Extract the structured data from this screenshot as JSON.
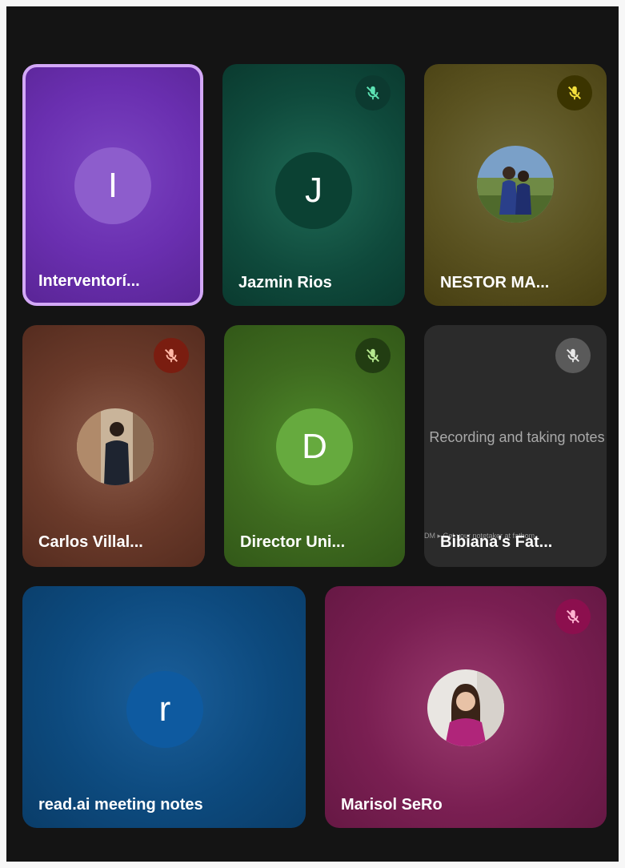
{
  "participants": [
    {
      "name": "Interventorí...",
      "initial": "I",
      "muted": false,
      "active": true,
      "background": "#6a2fb0",
      "avatar_color": "#8d5dcc"
    },
    {
      "name": "Jazmin Rios",
      "initial": "J",
      "muted": true,
      "active": false,
      "background": "#0f4a3c",
      "avatar_color": "#0b4133",
      "mute_badge_color": "#0c3a30",
      "mute_icon_color": "#5de3b4"
    },
    {
      "name": "NESTOR MA...",
      "photo": true,
      "muted": true,
      "active": false,
      "background": "#5a5220",
      "mute_badge_color": "#3b3400",
      "mute_icon_color": "#f3df3c"
    },
    {
      "name": "Carlos Villal...",
      "photo": true,
      "muted": true,
      "active": false,
      "background": "#6a3a2a",
      "mute_badge_color": "#7a1d10",
      "mute_icon_color": "#ffb7a5"
    },
    {
      "name": "Director Uni...",
      "initial": "D",
      "muted": true,
      "active": false,
      "background": "#3e6a1f",
      "avatar_color": "#66aa3e",
      "mute_badge_color": "#223d12",
      "mute_icon_color": "#b6e88f"
    },
    {
      "name": "Bibiana's Fat...",
      "muted": true,
      "active": false,
      "background": "#2b2b2b",
      "mute_badge_color": "#5a5a5a",
      "mute_icon_color": "#e8e8e8",
      "screen_text": "Recording and taking notes",
      "screen_strip": "DM ▸ Get your notetaker at fathom"
    },
    {
      "name": "read.ai meeting notes",
      "initial": "r",
      "muted": false,
      "active": false,
      "background": "#0d4a7e",
      "avatar_color": "#0e5aa0"
    },
    {
      "name": "Marisol SeRo",
      "photo": true,
      "muted": true,
      "active": false,
      "background": "#7a1f52",
      "mute_badge_color": "#8c0f4e",
      "mute_icon_color": "#ffb3d1"
    }
  ]
}
